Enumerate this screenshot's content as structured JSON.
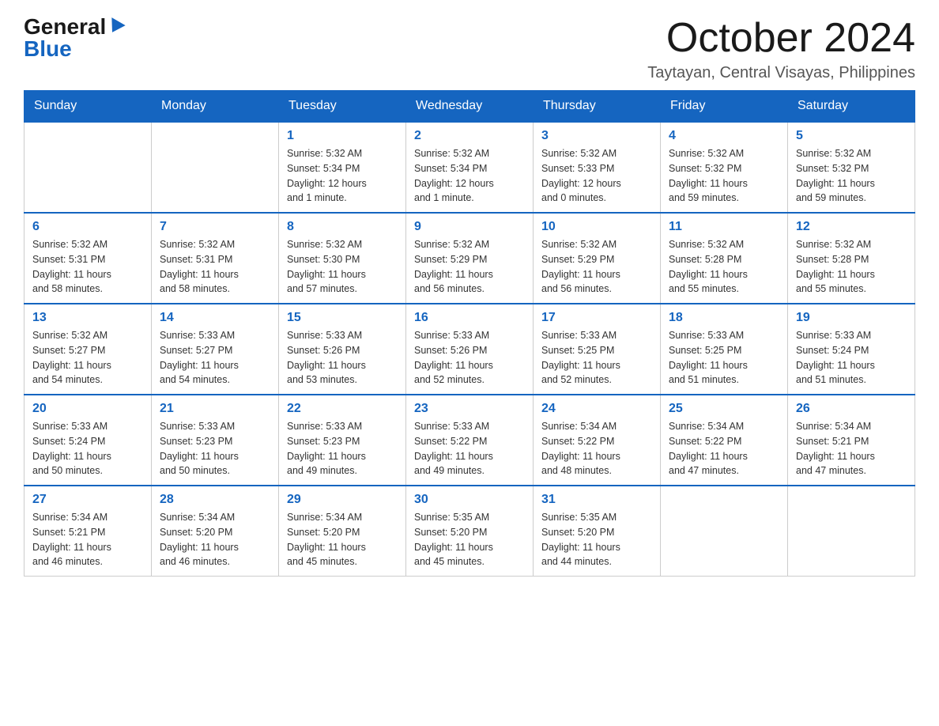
{
  "header": {
    "logo_general": "General",
    "logo_blue": "Blue",
    "month_title": "October 2024",
    "location": "Taytayan, Central Visayas, Philippines"
  },
  "days_of_week": [
    "Sunday",
    "Monday",
    "Tuesday",
    "Wednesday",
    "Thursday",
    "Friday",
    "Saturday"
  ],
  "weeks": [
    [
      {
        "day": "",
        "info": ""
      },
      {
        "day": "",
        "info": ""
      },
      {
        "day": "1",
        "info": "Sunrise: 5:32 AM\nSunset: 5:34 PM\nDaylight: 12 hours\nand 1 minute."
      },
      {
        "day": "2",
        "info": "Sunrise: 5:32 AM\nSunset: 5:34 PM\nDaylight: 12 hours\nand 1 minute."
      },
      {
        "day": "3",
        "info": "Sunrise: 5:32 AM\nSunset: 5:33 PM\nDaylight: 12 hours\nand 0 minutes."
      },
      {
        "day": "4",
        "info": "Sunrise: 5:32 AM\nSunset: 5:32 PM\nDaylight: 11 hours\nand 59 minutes."
      },
      {
        "day": "5",
        "info": "Sunrise: 5:32 AM\nSunset: 5:32 PM\nDaylight: 11 hours\nand 59 minutes."
      }
    ],
    [
      {
        "day": "6",
        "info": "Sunrise: 5:32 AM\nSunset: 5:31 PM\nDaylight: 11 hours\nand 58 minutes."
      },
      {
        "day": "7",
        "info": "Sunrise: 5:32 AM\nSunset: 5:31 PM\nDaylight: 11 hours\nand 58 minutes."
      },
      {
        "day": "8",
        "info": "Sunrise: 5:32 AM\nSunset: 5:30 PM\nDaylight: 11 hours\nand 57 minutes."
      },
      {
        "day": "9",
        "info": "Sunrise: 5:32 AM\nSunset: 5:29 PM\nDaylight: 11 hours\nand 56 minutes."
      },
      {
        "day": "10",
        "info": "Sunrise: 5:32 AM\nSunset: 5:29 PM\nDaylight: 11 hours\nand 56 minutes."
      },
      {
        "day": "11",
        "info": "Sunrise: 5:32 AM\nSunset: 5:28 PM\nDaylight: 11 hours\nand 55 minutes."
      },
      {
        "day": "12",
        "info": "Sunrise: 5:32 AM\nSunset: 5:28 PM\nDaylight: 11 hours\nand 55 minutes."
      }
    ],
    [
      {
        "day": "13",
        "info": "Sunrise: 5:32 AM\nSunset: 5:27 PM\nDaylight: 11 hours\nand 54 minutes."
      },
      {
        "day": "14",
        "info": "Sunrise: 5:33 AM\nSunset: 5:27 PM\nDaylight: 11 hours\nand 54 minutes."
      },
      {
        "day": "15",
        "info": "Sunrise: 5:33 AM\nSunset: 5:26 PM\nDaylight: 11 hours\nand 53 minutes."
      },
      {
        "day": "16",
        "info": "Sunrise: 5:33 AM\nSunset: 5:26 PM\nDaylight: 11 hours\nand 52 minutes."
      },
      {
        "day": "17",
        "info": "Sunrise: 5:33 AM\nSunset: 5:25 PM\nDaylight: 11 hours\nand 52 minutes."
      },
      {
        "day": "18",
        "info": "Sunrise: 5:33 AM\nSunset: 5:25 PM\nDaylight: 11 hours\nand 51 minutes."
      },
      {
        "day": "19",
        "info": "Sunrise: 5:33 AM\nSunset: 5:24 PM\nDaylight: 11 hours\nand 51 minutes."
      }
    ],
    [
      {
        "day": "20",
        "info": "Sunrise: 5:33 AM\nSunset: 5:24 PM\nDaylight: 11 hours\nand 50 minutes."
      },
      {
        "day": "21",
        "info": "Sunrise: 5:33 AM\nSunset: 5:23 PM\nDaylight: 11 hours\nand 50 minutes."
      },
      {
        "day": "22",
        "info": "Sunrise: 5:33 AM\nSunset: 5:23 PM\nDaylight: 11 hours\nand 49 minutes."
      },
      {
        "day": "23",
        "info": "Sunrise: 5:33 AM\nSunset: 5:22 PM\nDaylight: 11 hours\nand 49 minutes."
      },
      {
        "day": "24",
        "info": "Sunrise: 5:34 AM\nSunset: 5:22 PM\nDaylight: 11 hours\nand 48 minutes."
      },
      {
        "day": "25",
        "info": "Sunrise: 5:34 AM\nSunset: 5:22 PM\nDaylight: 11 hours\nand 47 minutes."
      },
      {
        "day": "26",
        "info": "Sunrise: 5:34 AM\nSunset: 5:21 PM\nDaylight: 11 hours\nand 47 minutes."
      }
    ],
    [
      {
        "day": "27",
        "info": "Sunrise: 5:34 AM\nSunset: 5:21 PM\nDaylight: 11 hours\nand 46 minutes."
      },
      {
        "day": "28",
        "info": "Sunrise: 5:34 AM\nSunset: 5:20 PM\nDaylight: 11 hours\nand 46 minutes."
      },
      {
        "day": "29",
        "info": "Sunrise: 5:34 AM\nSunset: 5:20 PM\nDaylight: 11 hours\nand 45 minutes."
      },
      {
        "day": "30",
        "info": "Sunrise: 5:35 AM\nSunset: 5:20 PM\nDaylight: 11 hours\nand 45 minutes."
      },
      {
        "day": "31",
        "info": "Sunrise: 5:35 AM\nSunset: 5:20 PM\nDaylight: 11 hours\nand 44 minutes."
      },
      {
        "day": "",
        "info": ""
      },
      {
        "day": "",
        "info": ""
      }
    ]
  ]
}
